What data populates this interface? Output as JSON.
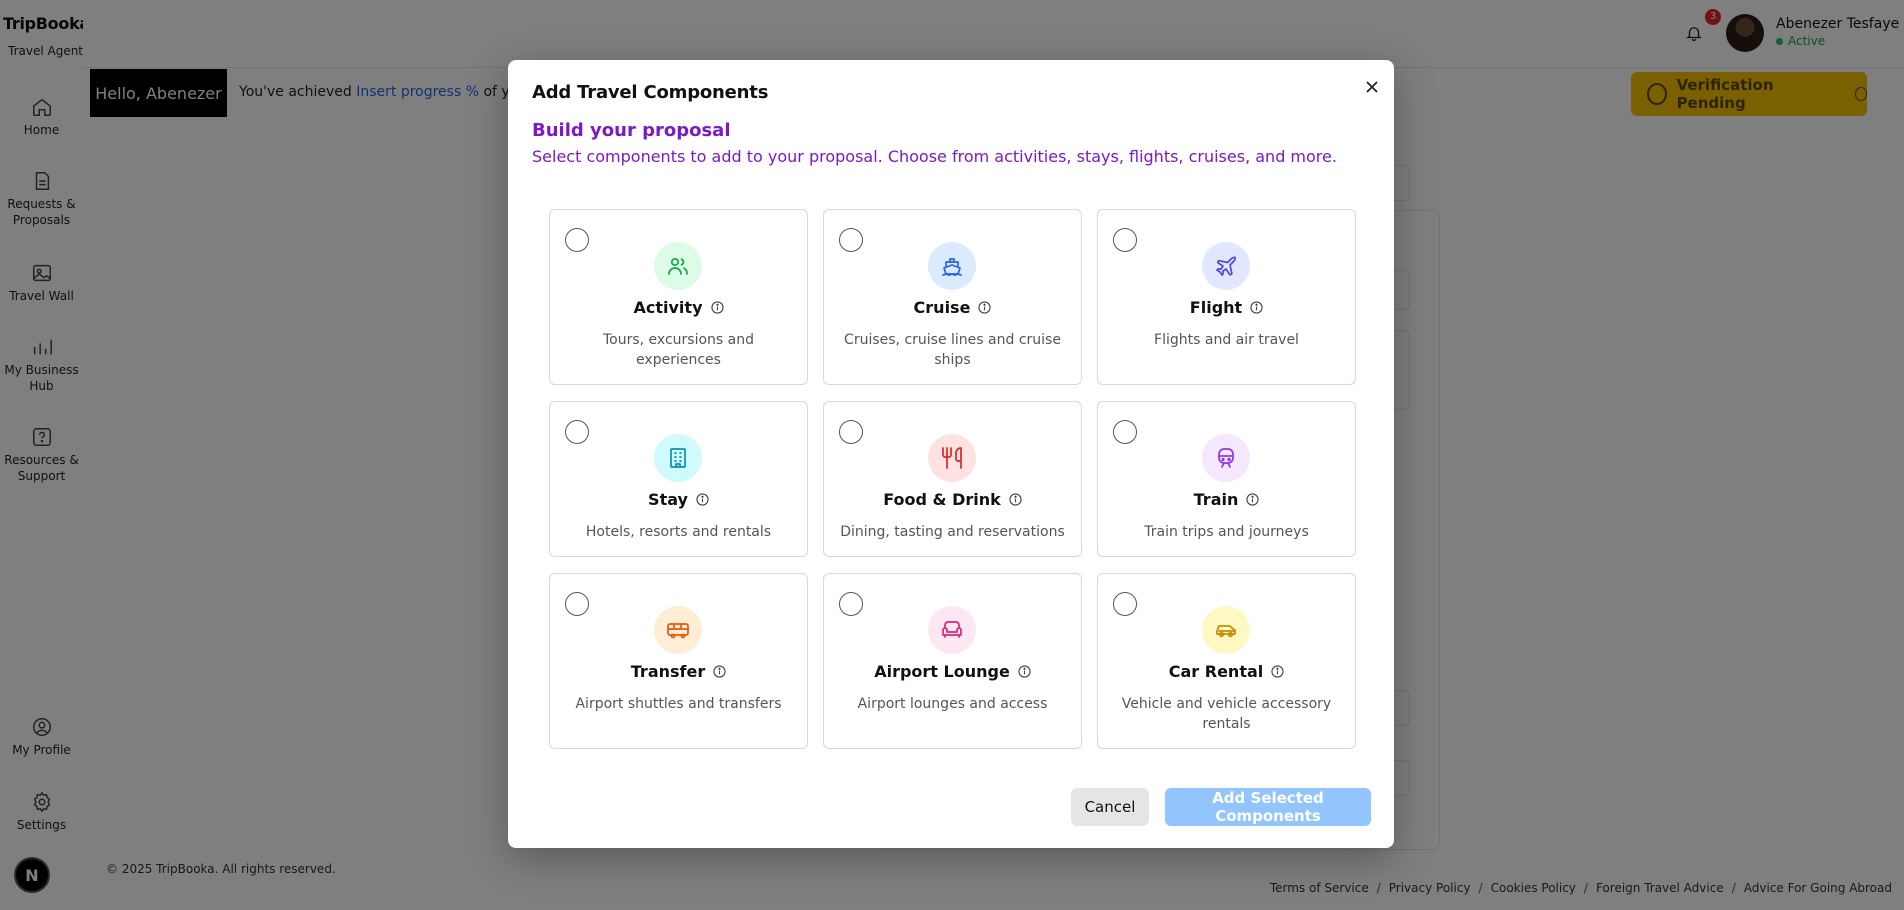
{
  "app": {
    "logo": "TripBooka.",
    "role": "Travel Agent"
  },
  "sidebar": {
    "items": [
      {
        "label": "Home",
        "icon": "home-icon"
      },
      {
        "label": "Requests & Proposals",
        "icon": "requests-icon"
      },
      {
        "label": "Travel Wall",
        "icon": "image-icon"
      },
      {
        "label": "My Business Hub",
        "icon": "chart-icon"
      },
      {
        "label": "Resources & Support",
        "icon": "help-icon"
      },
      {
        "label": "My Profile",
        "icon": "user-icon"
      },
      {
        "label": "Settings",
        "icon": "gear-icon"
      }
    ],
    "badge": "N"
  },
  "header": {
    "notification_count": "3",
    "user_name": "Abenezer Tesfaye",
    "user_status": "Active"
  },
  "greeting": {
    "hello": "Hello, Abenezer",
    "text_prefix": "You've achieved",
    "progress_link": "Insert progress %",
    "text_suffix": "of your",
    "verification": "Verification Pending"
  },
  "footer": {
    "copyright": "© 2025 TripBooka. All rights reserved.",
    "links": [
      "Terms of Service",
      "Privacy Policy",
      "Cookies Policy",
      "Foreign Travel Advice",
      "Advice For Going Abroad"
    ]
  },
  "modal": {
    "title": "Add Travel Components",
    "build_title": "Build your proposal",
    "build_subtitle": "Select components to add to your proposal. Choose from activities, stays, flights, cruises, and more.",
    "components": [
      {
        "name": "Activity",
        "description": "Tours, excursions and experiences",
        "icon": "users-icon",
        "bg": "#dcfce7",
        "color": "#16a34a",
        "selected": false
      },
      {
        "name": "Cruise",
        "description": "Cruises, cruise lines and cruise ships",
        "icon": "ship-icon",
        "bg": "#dbeafe",
        "color": "#2563eb",
        "selected": false
      },
      {
        "name": "Flight",
        "description": "Flights and air travel",
        "icon": "plane-icon",
        "bg": "#e0e7ff",
        "color": "#4f46e5",
        "selected": false
      },
      {
        "name": "Stay",
        "description": "Hotels, resorts and rentals",
        "icon": "building-icon",
        "bg": "#cffafe",
        "color": "#0891b2",
        "selected": false
      },
      {
        "name": "Food & Drink",
        "description": "Dining, tasting and reservations",
        "icon": "utensils-icon",
        "bg": "#fee2e2",
        "color": "#dc2626",
        "selected": false
      },
      {
        "name": "Train",
        "description": "Train trips and journeys",
        "icon": "train-icon",
        "bg": "#f3e8ff",
        "color": "#9333ea",
        "selected": false
      },
      {
        "name": "Transfer",
        "description": "Airport shuttles and transfers",
        "icon": "bus-icon",
        "bg": "#ffedd5",
        "color": "#ea580c",
        "selected": false
      },
      {
        "name": "Airport Lounge",
        "description": "Airport lounges and access",
        "icon": "sofa-icon",
        "bg": "#fce7f3",
        "color": "#db2777",
        "selected": false
      },
      {
        "name": "Car Rental",
        "description": "Vehicle and vehicle accessory rentals",
        "icon": "car-icon",
        "bg": "#fef9c3",
        "color": "#ca8a04",
        "selected": false
      }
    ],
    "cancel_label": "Cancel",
    "add_label": "Add Selected Components"
  }
}
